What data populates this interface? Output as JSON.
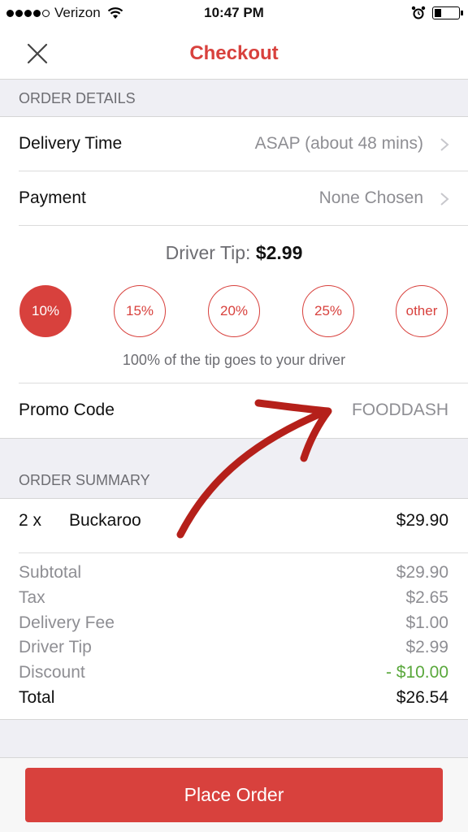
{
  "status_bar": {
    "carrier": "Verizon",
    "time": "10:47 PM",
    "battery_level": 0.3
  },
  "nav": {
    "title": "Checkout",
    "close_icon": "close-x-icon"
  },
  "order_details": {
    "header": "ORDER DETAILS",
    "delivery_time": {
      "label": "Delivery Time",
      "value": "ASAP (about 48 mins)"
    },
    "payment": {
      "label": "Payment",
      "value": "None Chosen"
    },
    "driver_tip": {
      "label": "Driver Tip:",
      "amount": "$2.99",
      "options": [
        "10%",
        "15%",
        "20%",
        "25%",
        "other"
      ],
      "selected": "10%",
      "note": "100% of the tip goes to your driver"
    },
    "promo": {
      "label": "Promo Code",
      "value": "FOODDASH"
    }
  },
  "order_summary": {
    "header": "ORDER SUMMARY",
    "items": [
      {
        "qty": "2 x",
        "name": "Buckaroo",
        "price": "$29.90"
      }
    ],
    "lines": [
      {
        "label": "Subtotal",
        "value": "$29.90"
      },
      {
        "label": "Tax",
        "value": "$2.65"
      },
      {
        "label": "Delivery Fee",
        "value": "$1.00"
      },
      {
        "label": "Driver Tip",
        "value": "$2.99"
      },
      {
        "label": "Discount",
        "value": "- $10.00"
      },
      {
        "label": "Total",
        "value": "$26.54"
      }
    ]
  },
  "place_order_label": "Place Order",
  "colors": {
    "accent": "#d8413d",
    "discount": "#5aa83c",
    "annotation": "#b5201a"
  }
}
